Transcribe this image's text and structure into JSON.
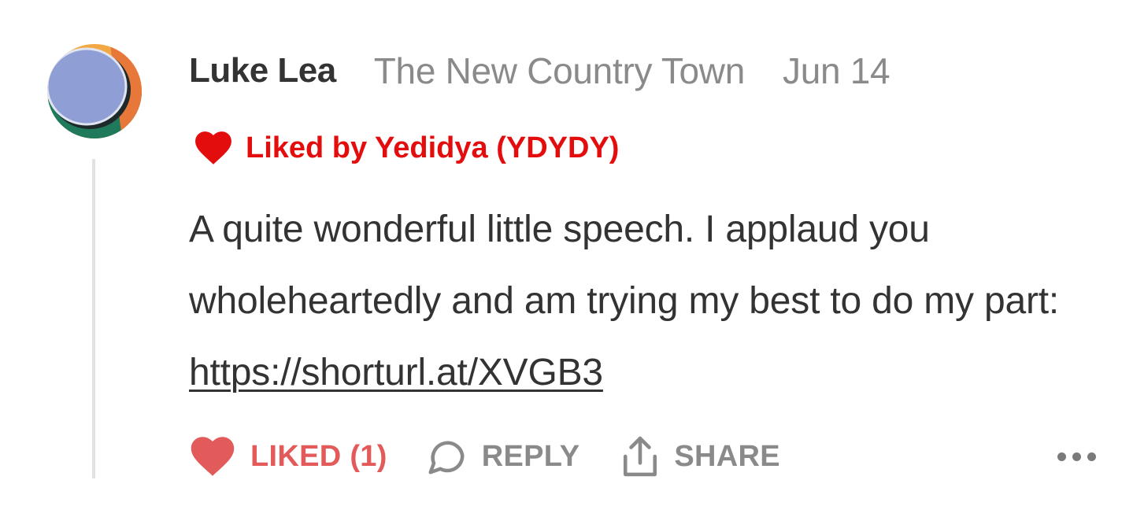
{
  "comment": {
    "author": "Luke Lea",
    "publication": "The New Country Town",
    "date": "Jun 14",
    "liked_by": "Liked by Yedidya (YDYDY)",
    "body_text": "A quite wonderful little speech. I applaud you wholeheartedly and am trying my best to do my part: ",
    "link_text": "https://shorturl.at/XVGB3"
  },
  "actions": {
    "liked_label": "LIKED (1)",
    "reply_label": "REPLY",
    "share_label": "SHARE"
  },
  "icons": {
    "avatar": "avatar-image",
    "liked_by": "heart-icon",
    "like": "heart-icon",
    "reply": "speech-bubble-icon",
    "share": "share-arrow-icon",
    "more": "more-dots-icon"
  },
  "colors": {
    "liked_by_red": "#e30d0d",
    "liked_action_red": "#e35a5a",
    "text_dark": "#333333",
    "text_muted": "#8a8a8a",
    "thread_line": "#e2e2e2"
  }
}
